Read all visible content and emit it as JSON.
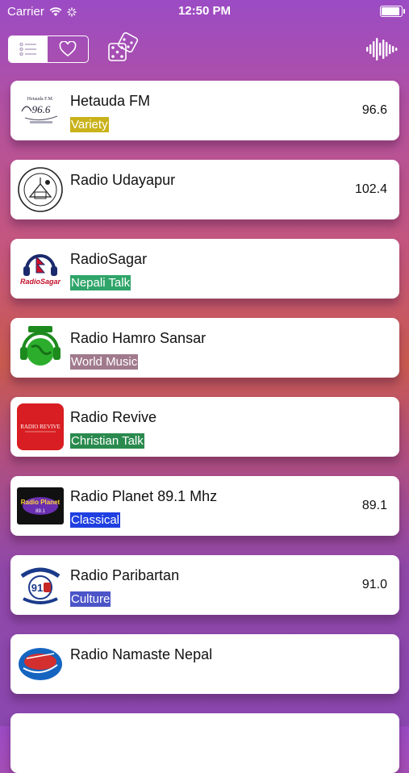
{
  "status": {
    "carrier": "Carrier",
    "time": "12:50 PM"
  },
  "toolbar": {
    "list_icon": "list-icon",
    "favorite_icon": "heart-icon",
    "random_icon": "dice-icon",
    "equalizer_icon": "waveform-icon"
  },
  "stations": [
    {
      "name": "Hetauda FM",
      "genre": "Variety",
      "genre_color": "#c9b21a",
      "frequency": "96.6",
      "logo_text": "96.6",
      "logo_caption": "Hetauda F.M."
    },
    {
      "name": "Radio Udayapur",
      "genre": "",
      "genre_color": "",
      "frequency": "102.4"
    },
    {
      "name": "RadioSagar",
      "genre": "Nepali Talk",
      "genre_color": "#2fa56a",
      "frequency": "",
      "logo_text": "RadioSagar"
    },
    {
      "name": "Radio Hamro Sansar",
      "genre": "World Music",
      "genre_color": "#a07a8c",
      "frequency": ""
    },
    {
      "name": "Radio Revive",
      "genre": "Christian Talk",
      "genre_color": "#2a8a4e",
      "frequency": "",
      "logo_text": "RADIO REVIVE"
    },
    {
      "name": "Radio Planet 89.1 Mhz",
      "genre": "Classical",
      "genre_color": "#1f3fe0",
      "frequency": "89.1",
      "logo_text": "Radio Planet"
    },
    {
      "name": "Radio Paribartan",
      "genre": "Culture",
      "genre_color": "#4b55c8",
      "frequency": "91.0",
      "logo_text": "91"
    },
    {
      "name": "Radio Namaste Nepal",
      "genre": "",
      "genre_color": "",
      "frequency": ""
    }
  ]
}
